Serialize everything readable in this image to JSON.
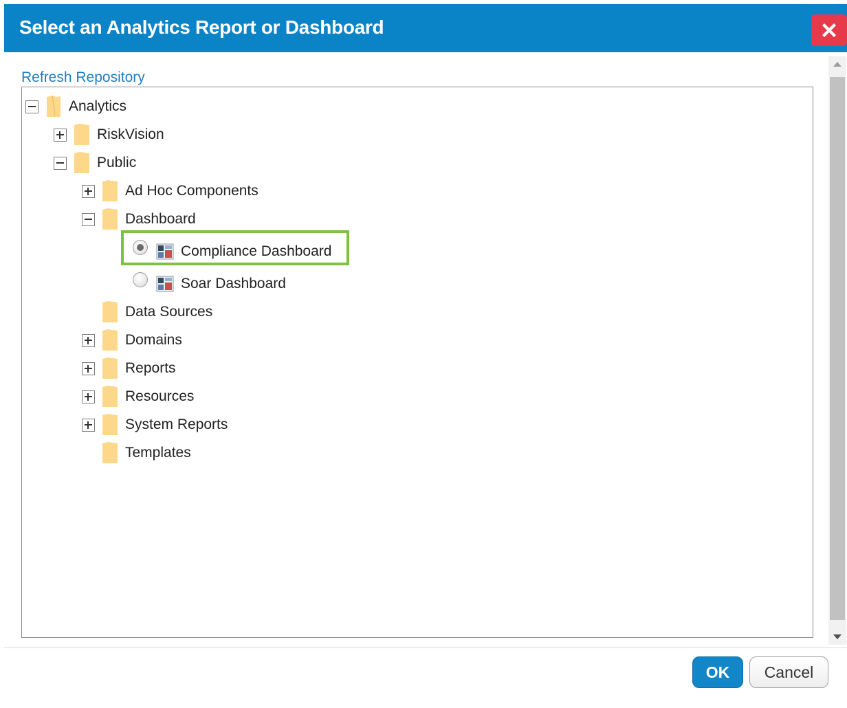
{
  "dialog": {
    "title": "Select an Analytics Report or Dashboard",
    "close_icon": "close-x-icon",
    "colors": {
      "title_bar": "#0a84c7",
      "close_button": "#e63a4b",
      "ok_button": "#1187c9",
      "highlight": "#7cc142",
      "folder": "#fdd78a"
    }
  },
  "refresh_link": "Refresh Repository",
  "tree": {
    "analytics": {
      "label": "Analytics",
      "expanded": true,
      "icon": "folder-icon"
    },
    "riskvision": {
      "label": "RiskVision",
      "expanded": false,
      "icon": "folder-icon"
    },
    "public": {
      "label": "Public",
      "expanded": true,
      "icon": "folder-icon"
    },
    "ad_hoc_components": {
      "label": "Ad Hoc Components",
      "expanded": false,
      "icon": "folder-icon"
    },
    "dashboard": {
      "label": "Dashboard",
      "expanded": true,
      "icon": "folder-icon"
    },
    "compliance_dashboard": {
      "label": "Compliance Dashboard",
      "selected": true,
      "icon": "dashboard-icon"
    },
    "soar_dashboard": {
      "label": "Soar Dashboard",
      "selected": false,
      "icon": "dashboard-icon"
    },
    "data_sources": {
      "label": "Data Sources",
      "icon": "folder-icon"
    },
    "domains": {
      "label": "Domains",
      "expanded": false,
      "icon": "folder-icon"
    },
    "reports": {
      "label": "Reports",
      "expanded": false,
      "icon": "folder-icon"
    },
    "resources": {
      "label": "Resources",
      "expanded": false,
      "icon": "folder-icon"
    },
    "system_reports": {
      "label": "System Reports",
      "expanded": false,
      "icon": "folder-icon"
    },
    "templates": {
      "label": "Templates",
      "icon": "folder-icon"
    }
  },
  "buttons": {
    "ok": "OK",
    "cancel": "Cancel"
  }
}
